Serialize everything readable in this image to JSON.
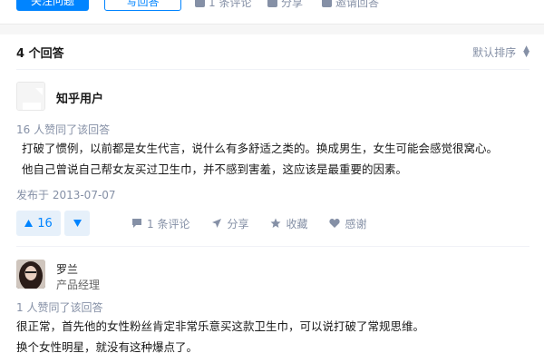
{
  "topbar": {
    "primary_button": "关注问题",
    "outline_button": "写回答",
    "comment_action": "1 条评论",
    "share_action": "分享",
    "invite_action": "邀请回答"
  },
  "answers_header": {
    "count": "4 个回答",
    "sort": "默认排序"
  },
  "answers": [
    {
      "author": "知乎用户",
      "voters": "16 人赞同了该回答",
      "content": [
        "打破了惯例，以前都是女生代言，说什么有多舒适之类的。换成男生，女生可能会感觉很窝心。",
        "他自己曾说自己帮女友买过卫生巾，并不感到害羞，这应该是最重要的因素。"
      ],
      "published": "发布于 2013-07-07",
      "upvotes": "16",
      "comment": "1 条评论",
      "share": "分享",
      "favorite": "收藏",
      "thanks": "感谢"
    },
    {
      "author": "罗兰",
      "title": "产品经理",
      "voters": "1 人赞同了该回答",
      "content": [
        "很正常，首先他的女性粉丝肯定非常乐意买这款卫生巾，可以说打破了常规思维。",
        "换个女性明星，就没有这种爆点了。"
      ]
    }
  ],
  "colors": {
    "accent": "#0084ff",
    "muted": "#8590a6",
    "vote_bg": "#e6f0fa"
  }
}
